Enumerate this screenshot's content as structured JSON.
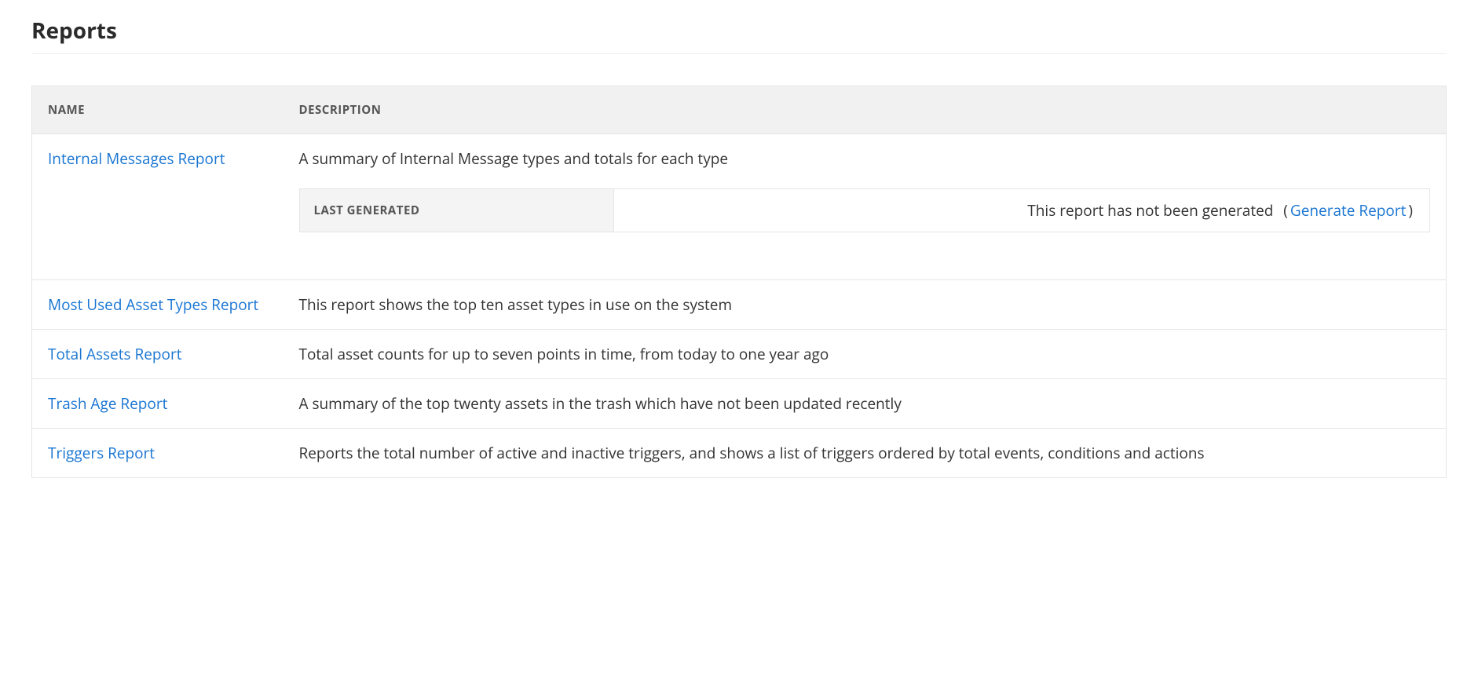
{
  "page": {
    "title": "Reports"
  },
  "table": {
    "headers": {
      "name": "NAME",
      "description": "DESCRIPTION"
    }
  },
  "reports": [
    {
      "name": "Internal Messages Report",
      "description": "A summary of Internal Message types and totals for each type",
      "expanded": true,
      "last_generated_label": "LAST GENERATED",
      "last_generated_status": "This report has not been generated",
      "generate_action": "Generate Report"
    },
    {
      "name": "Most Used Asset Types Report",
      "description": "This report shows the top ten asset types in use on the system"
    },
    {
      "name": "Total Assets Report",
      "description": "Total asset counts for up to seven points in time, from today to one year ago"
    },
    {
      "name": "Trash Age Report",
      "description": "A summary of the top twenty assets in the trash which have not been updated recently"
    },
    {
      "name": "Triggers Report",
      "description": "Reports the total number of active and inactive triggers, and shows a list of triggers ordered by total events, conditions and actions"
    }
  ]
}
